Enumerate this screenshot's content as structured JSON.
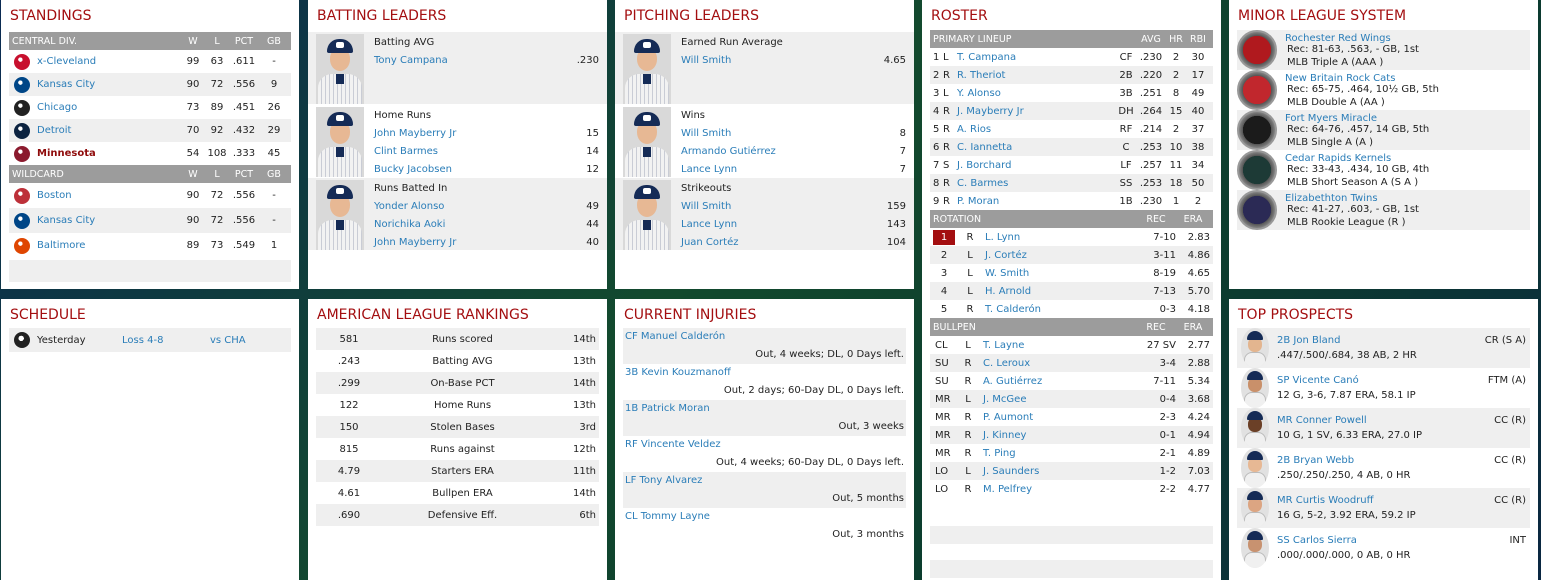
{
  "standings": {
    "title": "STANDINGS",
    "div_header": {
      "name": "CENTRAL DIV.",
      "w": "W",
      "l": "L",
      "pct": "PCT",
      "gb": "GB"
    },
    "division": [
      {
        "team": "x-Cleveland",
        "w": "99",
        "l": "63",
        "pct": ".611",
        "gb": "-",
        "logo_color": "#c8102e",
        "highlight": false
      },
      {
        "team": "Kansas City",
        "w": "90",
        "l": "72",
        "pct": ".556",
        "gb": "9",
        "logo_color": "#004687",
        "highlight": false
      },
      {
        "team": "Chicago",
        "w": "73",
        "l": "89",
        "pct": ".451",
        "gb": "26",
        "logo_color": "#222222",
        "highlight": false
      },
      {
        "team": "Detroit",
        "w": "70",
        "l": "92",
        "pct": ".432",
        "gb": "29",
        "logo_color": "#0c2340",
        "highlight": false
      },
      {
        "team": "Minnesota",
        "w": "54",
        "l": "108",
        "pct": ".333",
        "gb": "45",
        "logo_color": "#8b1a2e",
        "highlight": true
      }
    ],
    "wc_header": {
      "name": "WILDCARD",
      "w": "W",
      "l": "L",
      "pct": "PCT",
      "gb": "GB"
    },
    "wildcard": [
      {
        "team": "Boston",
        "w": "90",
        "l": "72",
        "pct": ".556",
        "gb": "-",
        "logo_color": "#bd3039"
      },
      {
        "team": "Kansas City",
        "w": "90",
        "l": "72",
        "pct": ".556",
        "gb": "-",
        "logo_color": "#004687"
      },
      {
        "team": "Baltimore",
        "w": "89",
        "l": "73",
        "pct": ".549",
        "gb": "1",
        "logo_color": "#df4601"
      }
    ]
  },
  "batting_leaders": {
    "title": "BATTING LEADERS",
    "groups": [
      {
        "category": "Batting AVG",
        "rows": [
          {
            "name": "Tony Campana",
            "value": ".230"
          }
        ]
      },
      {
        "category": "Home Runs",
        "rows": [
          {
            "name": "John Mayberry Jr",
            "value": "15"
          },
          {
            "name": "Clint Barmes",
            "value": "14"
          },
          {
            "name": "Bucky Jacobsen",
            "value": "12"
          }
        ]
      },
      {
        "category": "Runs Batted In",
        "rows": [
          {
            "name": "Yonder Alonso",
            "value": "49"
          },
          {
            "name": "Norichika Aoki",
            "value": "44"
          },
          {
            "name": "John Mayberry Jr",
            "value": "40"
          }
        ]
      }
    ]
  },
  "pitching_leaders": {
    "title": "PITCHING LEADERS",
    "groups": [
      {
        "category": "Earned Run Average",
        "rows": [
          {
            "name": "Will Smith",
            "value": "4.65"
          }
        ]
      },
      {
        "category": "Wins",
        "rows": [
          {
            "name": "Will Smith",
            "value": "8"
          },
          {
            "name": "Armando Gutiérrez",
            "value": "7"
          },
          {
            "name": "Lance Lynn",
            "value": "7"
          }
        ]
      },
      {
        "category": "Strikeouts",
        "rows": [
          {
            "name": "Will Smith",
            "value": "159"
          },
          {
            "name": "Lance Lynn",
            "value": "143"
          },
          {
            "name": "Juan Cortéz",
            "value": "104"
          }
        ]
      }
    ]
  },
  "roster": {
    "title": "ROSTER",
    "lineup_header": {
      "name": "PRIMARY LINEUP",
      "avg": "AVG",
      "hr": "HR",
      "rbi": "RBI"
    },
    "lineup": [
      {
        "n": "1",
        "h": "L",
        "name": "T. Campana",
        "pos": "CF",
        "avg": ".230",
        "hr": "2",
        "rbi": "30"
      },
      {
        "n": "2",
        "h": "R",
        "name": "R. Theriot",
        "pos": "2B",
        "avg": ".220",
        "hr": "2",
        "rbi": "17"
      },
      {
        "n": "3",
        "h": "L",
        "name": "Y. Alonso",
        "pos": "3B",
        "avg": ".251",
        "hr": "8",
        "rbi": "49"
      },
      {
        "n": "4",
        "h": "R",
        "name": "J. Mayberry Jr",
        "pos": "DH",
        "avg": ".264",
        "hr": "15",
        "rbi": "40"
      },
      {
        "n": "5",
        "h": "R",
        "name": "A. Rios",
        "pos": "RF",
        "avg": ".214",
        "hr": "2",
        "rbi": "37"
      },
      {
        "n": "6",
        "h": "R",
        "name": "C. Iannetta",
        "pos": "C",
        "avg": ".253",
        "hr": "10",
        "rbi": "38"
      },
      {
        "n": "7",
        "h": "S",
        "name": "J. Borchard",
        "pos": "LF",
        "avg": ".257",
        "hr": "11",
        "rbi": "34"
      },
      {
        "n": "8",
        "h": "R",
        "name": "C. Barmes",
        "pos": "SS",
        "avg": ".253",
        "hr": "18",
        "rbi": "50"
      },
      {
        "n": "9",
        "h": "R",
        "name": "P. Moran",
        "pos": "1B",
        "avg": ".230",
        "hr": "1",
        "rbi": "2"
      }
    ],
    "rotation_header": {
      "name": "ROTATION",
      "rec": "REC",
      "era": "ERA"
    },
    "rotation": [
      {
        "n": "1",
        "h": "R",
        "name": "L. Lynn",
        "rec": "7-10",
        "era": "2.83",
        "active": true
      },
      {
        "n": "2",
        "h": "L",
        "name": "J. Cortéz",
        "rec": "3-11",
        "era": "4.86",
        "active": false
      },
      {
        "n": "3",
        "h": "L",
        "name": "W. Smith",
        "rec": "8-19",
        "era": "4.65",
        "active": false
      },
      {
        "n": "4",
        "h": "L",
        "name": "H. Arnold",
        "rec": "7-13",
        "era": "5.70",
        "active": false
      },
      {
        "n": "5",
        "h": "R",
        "name": "T. Calderón",
        "rec": "0-3",
        "era": "4.18",
        "active": false
      }
    ],
    "bullpen_header": {
      "name": "BULLPEN",
      "rec": "REC",
      "era": "ERA"
    },
    "bullpen": [
      {
        "role": "CL",
        "h": "L",
        "name": "T. Layne",
        "rec": "27 SV",
        "era": "2.77"
      },
      {
        "role": "SU",
        "h": "R",
        "name": "C. Leroux",
        "rec": "3-4",
        "era": "2.88"
      },
      {
        "role": "SU",
        "h": "R",
        "name": "A. Gutiérrez",
        "rec": "7-11",
        "era": "5.34"
      },
      {
        "role": "MR",
        "h": "L",
        "name": "J. McGee",
        "rec": "0-4",
        "era": "3.68"
      },
      {
        "role": "MR",
        "h": "R",
        "name": "P. Aumont",
        "rec": "2-3",
        "era": "4.24"
      },
      {
        "role": "MR",
        "h": "R",
        "name": "J. Kinney",
        "rec": "0-1",
        "era": "4.94"
      },
      {
        "role": "MR",
        "h": "R",
        "name": "T. Ping",
        "rec": "2-1",
        "era": "4.89"
      },
      {
        "role": "LO",
        "h": "L",
        "name": "J. Saunders",
        "rec": "1-2",
        "era": "7.03"
      },
      {
        "role": "LO",
        "h": "R",
        "name": "M. Pelfrey",
        "rec": "2-2",
        "era": "4.77"
      }
    ]
  },
  "minor_league": {
    "title": "MINOR LEAGUE SYSTEM",
    "teams": [
      {
        "name": "Rochester Red Wings",
        "rec": "Rec: 81-63, .563, - GB, 1st",
        "level": "MLB Triple A (AAA )",
        "color": "#b0191e"
      },
      {
        "name": "New Britain Rock Cats",
        "rec": "Rec: 65-75, .464, 10½ GB, 5th",
        "level": "MLB Double A (AA )",
        "color": "#c1272d"
      },
      {
        "name": "Fort Myers Miracle",
        "rec": "Rec: 64-76, .457, 14 GB, 5th",
        "level": "MLB Single A (A )",
        "color": "#1b1b1b"
      },
      {
        "name": "Cedar Rapids Kernels",
        "rec": "Rec: 33-43, .434, 10 GB, 4th",
        "level": "MLB Short Season A (S A )",
        "color": "#1d3a36"
      },
      {
        "name": "Elizabethton Twins",
        "rec": "Rec: 41-27, .603, - GB, 1st",
        "level": "MLB Rookie League (R )",
        "color": "#2b2a55"
      }
    ]
  },
  "schedule": {
    "title": "SCHEDULE",
    "rows": [
      {
        "day": "Yesterday",
        "result": "Loss 4-8",
        "opp": "vs CHA",
        "logo_color": "#222222"
      }
    ]
  },
  "al_rankings": {
    "title": "AMERICAN LEAGUE RANKINGS",
    "rows": [
      {
        "value": "581",
        "stat": "Runs scored",
        "rank": "14th"
      },
      {
        "value": ".243",
        "stat": "Batting AVG",
        "rank": "13th"
      },
      {
        "value": ".299",
        "stat": "On-Base PCT",
        "rank": "14th"
      },
      {
        "value": "122",
        "stat": "Home Runs",
        "rank": "13th"
      },
      {
        "value": "150",
        "stat": "Stolen Bases",
        "rank": "3rd"
      },
      {
        "value": "815",
        "stat": "Runs against",
        "rank": "12th"
      },
      {
        "value": "4.79",
        "stat": "Starters ERA",
        "rank": "11th"
      },
      {
        "value": "4.61",
        "stat": "Bullpen ERA",
        "rank": "14th"
      },
      {
        "value": ".690",
        "stat": "Defensive Eff.",
        "rank": "6th"
      }
    ]
  },
  "injuries": {
    "title": "CURRENT INJURIES",
    "rows": [
      {
        "player": "CF Manuel Calderón",
        "status": "Out, 4 weeks; DL, 0 Days left."
      },
      {
        "player": "3B Kevin Kouzmanoff",
        "status": "Out, 2 days; 60-Day DL, 0 Days left."
      },
      {
        "player": "1B Patrick Moran",
        "status": "Out, 3 weeks"
      },
      {
        "player": "RF Vincente Veldez",
        "status": "Out, 4 weeks; 60-Day DL, 0 Days left."
      },
      {
        "player": "LF Tony Alvarez",
        "status": "Out, 5 months"
      },
      {
        "player": "CL Tommy Layne",
        "status": "Out, 3 months"
      }
    ]
  },
  "prospects": {
    "title": "TOP PROSPECTS",
    "rows": [
      {
        "name": "2B Jon Bland",
        "level": "CR (S A)",
        "line": ".447/.500/.684, 38 AB, 2 HR",
        "skin": "#e3b58f"
      },
      {
        "name": "SP Vicente Canó",
        "level": "FTM (A)",
        "line": "12 G, 3-6, 7.87 ERA, 58.1 IP",
        "skin": "#c9906a"
      },
      {
        "name": "MR Conner Powell",
        "level": "CC (R)",
        "line": "10 G, 1 SV, 6.33 ERA, 27.0 IP",
        "skin": "#6b4027"
      },
      {
        "name": "2B Bryan Webb",
        "level": "CC (R)",
        "line": ".250/.250/.250, 4 AB, 0 HR",
        "skin": "#e7b894"
      },
      {
        "name": "MR Curtis Woodruff",
        "level": "CC (R)",
        "line": "16 G, 5-2, 3.92 ERA, 59.2 IP",
        "skin": "#dca582"
      },
      {
        "name": "SS Carlos Sierra",
        "level": "INT",
        "line": ".000/.000/.000, 0 AB, 0 HR",
        "skin": "#c89270"
      }
    ]
  }
}
